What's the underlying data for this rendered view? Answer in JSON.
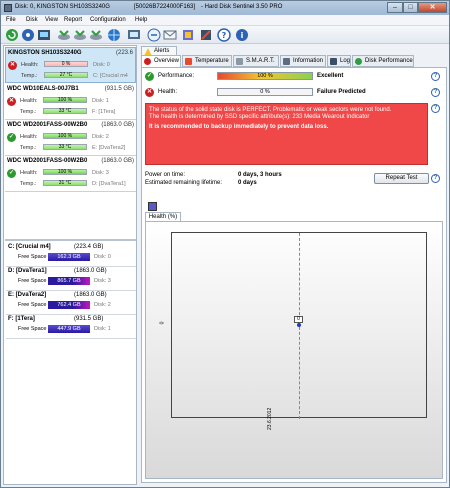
{
  "title": {
    "left": "Disk: 0, KINGSTON SH103S3240G",
    "mid": "[50026B7224000F163]",
    "right": "- Hard Disk Sentinel 3.50 PRO",
    "min": "–",
    "max": "□",
    "close": "✕"
  },
  "menu": [
    "File",
    "Disk",
    "View",
    "Report",
    "Configuration",
    "Help"
  ],
  "toolbar": {
    "icons": [
      "refresh-icon",
      "disk-icon",
      "report-icon",
      "schedule-icon",
      "tools-icon",
      "settings-icon",
      "globe-icon",
      "monitor-icon",
      "update-icon",
      "mail-icon",
      "palette-icon",
      "alarm-icon",
      "help-icon",
      "info-icon"
    ]
  },
  "disks": [
    {
      "name": "KINGSTON SH103S3240G",
      "size": "(223.6",
      "status": "bad",
      "health_label": "Health:",
      "health": "0 %",
      "temp_label": "Temp.:",
      "temp": "27 °C",
      "extra1": "Disk: 0",
      "extra2": "C: [Crucial m4"
    },
    {
      "name": "WDC WD10EALS-00J7B1",
      "size": "(931.5 GB)",
      "status": "bad",
      "health_label": "Health:",
      "health": "100 %",
      "temp_label": "Temp.:",
      "temp": "33 °C",
      "extra1": "Disk: 1",
      "extra2": "F: [1Tera]"
    },
    {
      "name": "WDC WD2001FASS-00W2B0",
      "size": "(1863.0 GB)",
      "status": "good",
      "health_label": "Health:",
      "health": "100 %",
      "temp_label": "Temp.:",
      "temp": "33 °C",
      "extra1": "Disk: 2",
      "extra2": "E: [DvaTera2]"
    },
    {
      "name": "WDC WD2001FASS-00W2B0",
      "size": "(1863.0 GB)",
      "status": "good",
      "health_label": "Health:",
      "health": "100 %",
      "temp_label": "Temp.:",
      "temp": "31 °C",
      "extra1": "Disk: 3",
      "extra2": "D: [DvaTera1]"
    }
  ],
  "partitions": [
    {
      "name": "C: [Crucial m4]",
      "size": "(223.4 GB)",
      "free_label": "Free Space",
      "free": "162.3 GB",
      "disk": "Disk: 0"
    },
    {
      "name": "D: [DvaTera1]",
      "size": "(1863.0 GB)",
      "free_label": "Free Space",
      "free": "865.7 GB",
      "disk": "Disk: 3"
    },
    {
      "name": "E: [DvaTera2]",
      "size": "(1863.0 GB)",
      "free_label": "Free Space",
      "free": "762.4 GB",
      "disk": "Disk: 2"
    },
    {
      "name": "F: [1Tera]",
      "size": "(931.5 GB)",
      "free_label": "Free Space",
      "free": "447.9 GB",
      "disk": "Disk: 1"
    }
  ],
  "alerts_label": "Alerts",
  "tabs": [
    "Overview",
    "Temperature",
    "S.M.A.R.T.",
    "Information",
    "Log",
    "Disk Performance"
  ],
  "overview": {
    "performance_label": "Performance:",
    "performance_value": "100 %",
    "performance_text": "Excellent",
    "performance_level": 1.0,
    "health_label": "Health:",
    "health_value": "0 %",
    "health_text": "Failure Predicted",
    "health_level": 0.0,
    "message_lines": [
      "The status of the solid state disk is PERFECT. Problematic or weak sectors were not found.",
      "The health is determined by SSD specific attribute(s): 233 Media Wearout Indicator"
    ],
    "message_bold": "It is recommended to backup immediately to prevent data loss.",
    "power_on_label": "Power on time:",
    "power_on_value": "0 days, 3 hours",
    "lifetime_label": "Estimated remaining lifetime:",
    "lifetime_value": "0 days",
    "repeat_test": "Repeat Test"
  },
  "chart_data": {
    "type": "line",
    "title": "Health (%)",
    "x": [
      "23.6.2012"
    ],
    "series": [
      {
        "values": [
          0
        ]
      }
    ],
    "y_tick": "0",
    "data_label": "0",
    "grid": false
  },
  "colors": {
    "alert_red": "#f04848",
    "selected_row": "#cfe6f7",
    "partition_bar": "#2a1a9e"
  }
}
